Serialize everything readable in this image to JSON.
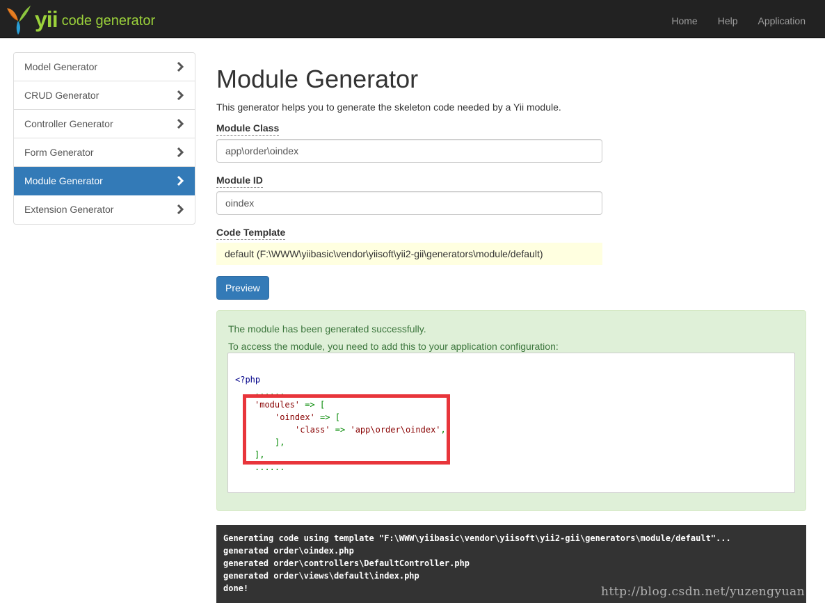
{
  "header": {
    "brand_yii": "yii",
    "brand_sub": "code generator",
    "nav": [
      "Home",
      "Help",
      "Application"
    ]
  },
  "sidebar": {
    "items": [
      {
        "label": "Model Generator"
      },
      {
        "label": "CRUD Generator"
      },
      {
        "label": "Controller Generator"
      },
      {
        "label": "Form Generator"
      },
      {
        "label": "Module Generator",
        "active": true
      },
      {
        "label": "Extension Generator"
      }
    ]
  },
  "main": {
    "title": "Module Generator",
    "description": "This generator helps you to generate the skeleton code needed by a Yii module.",
    "module_class": {
      "label": "Module Class",
      "value": "app\\order\\oindex"
    },
    "module_id": {
      "label": "Module ID",
      "value": "oindex"
    },
    "code_template": {
      "label": "Code Template",
      "value": "default (F:\\WWW\\yiibasic\\vendor\\yiisoft\\yii2-gii\\generators\\module/default)"
    },
    "preview_label": "Preview"
  },
  "result": {
    "success": "The module has been generated successfully.",
    "instruction": "To access the module, you need to add this to your application configuration:",
    "code": {
      "open_tag": "<?php",
      "dots": "......",
      "modules_key": "'modules'",
      "oindex_key": "'oindex'",
      "class_key": "'class'",
      "class_value": "'app\\order\\oindex'",
      "arrow_open": " => [",
      "arrow": " => ",
      "close_inner": "],",
      "close_outer": "],",
      "comma": ","
    }
  },
  "console": {
    "lines": [
      "Generating code using template \"F:\\WWW\\yiibasic\\vendor\\yiisoft\\yii2-gii\\generators\\module/default\"...",
      "generated order\\oindex.php",
      "generated order\\controllers\\DefaultController.php",
      "generated order\\views\\default\\index.php",
      "done!"
    ]
  },
  "watermark": "http://blog.csdn.net/yuzengyuan",
  "colors": {
    "navbar": "#222222",
    "active": "#337ab7",
    "alert_bg": "#dff0d8",
    "alert_text": "#3c763d",
    "highlight_border": "#e8353b",
    "template_bg": "#ffffe0",
    "console_bg": "#333333"
  }
}
